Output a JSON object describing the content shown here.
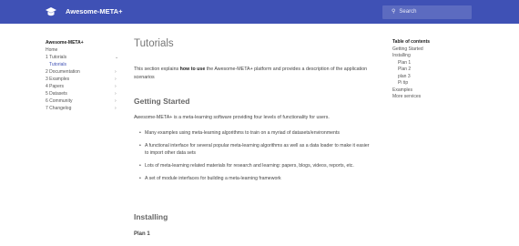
{
  "header": {
    "logo_icon": "graduation-cap-icon",
    "site_title": "Awesome-META+",
    "search_placeholder": "Search",
    "bar_color": "#3f51b5"
  },
  "left_nav": {
    "title": "Awesome-META+",
    "items": [
      {
        "label": "Home",
        "expandable": false
      },
      {
        "label": "1 Tutorials",
        "expandable": true,
        "expanded": true
      },
      {
        "label": "Tutorials",
        "expandable": false,
        "active": true
      },
      {
        "label": "2 Documentation",
        "expandable": true
      },
      {
        "label": "3 Examples",
        "expandable": true
      },
      {
        "label": "4 Papers",
        "expandable": true
      },
      {
        "label": "5 Datasets",
        "expandable": true
      },
      {
        "label": "6 Community",
        "expandable": true
      },
      {
        "label": "7 Changelog",
        "expandable": true
      }
    ]
  },
  "main": {
    "title": "Tutorials",
    "intro_before": "This section explains ",
    "intro_bold": "how to use",
    "intro_after": " the Awesome-META+ platform and provides a description of the application scenarios",
    "getting_started_heading": "Getting Started",
    "getting_started_text": "Awesome-META+ is a meta-learning software providing four levels of functionality for users.",
    "bullets": [
      "Many examples using meta-learning algorithms to train on a myriad of datasets/environments",
      "A functional interface for several popular meta-learning algorithms as well as a data loader to make it easier to import other data sets",
      "Lots of meta-learning related materials for research and learning: papers, blogs, videos, reports, etc.",
      "A set of module interfaces for building a meta-learning framework"
    ],
    "installing_heading": "Installing",
    "plan1_heading": "Plan 1"
  },
  "toc": {
    "title": "Table of contents",
    "items": [
      {
        "label": "Getting Started",
        "level": 1
      },
      {
        "label": "Installing",
        "level": 1
      },
      {
        "label": "Plan 1",
        "level": 2
      },
      {
        "label": "Plan 2",
        "level": 2
      },
      {
        "label": "plan 3",
        "level": 2
      },
      {
        "label": "Pi tip",
        "level": 2
      },
      {
        "label": "Examples",
        "level": 1
      },
      {
        "label": "More services",
        "level": 1
      }
    ]
  }
}
